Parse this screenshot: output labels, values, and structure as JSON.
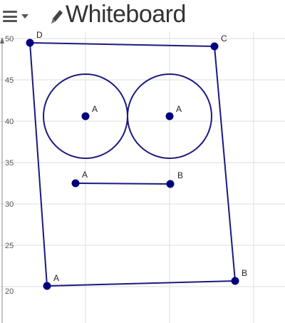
{
  "header": {
    "menu_icon": "hamburger-menu-icon",
    "dropdown_icon": "caret-down-icon",
    "pencil_icon": "pencil-icon",
    "title": "Whiteboard"
  },
  "axis": {
    "y_ticks": [
      "50",
      "45",
      "40",
      "35",
      "30",
      "25",
      "20"
    ],
    "y_values": [
      50,
      45,
      40,
      35,
      30,
      25,
      20
    ]
  },
  "points": {
    "D": "D",
    "C": "C",
    "A_bottom": "A",
    "B_bottom": "B",
    "A_circle1": "A",
    "A_circle2": "A",
    "A_segment": "A",
    "B_segment": "B"
  },
  "colors": {
    "stroke": "#1a1a80",
    "point": "#00007f",
    "grid": "#dddddd",
    "axis": "#888888"
  }
}
